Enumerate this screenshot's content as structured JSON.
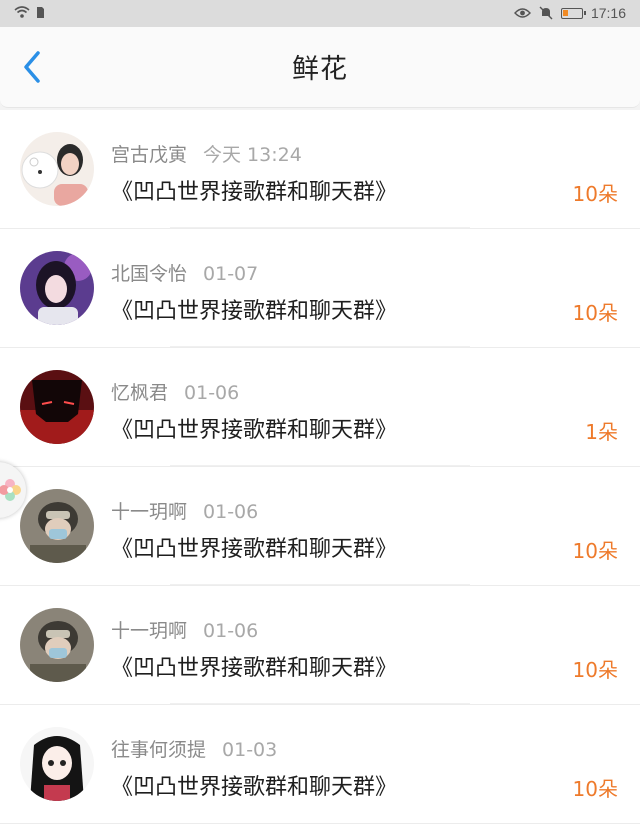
{
  "status_bar": {
    "time": "17:16",
    "icons": [
      "wifi-icon",
      "sim-icon",
      "eye-icon",
      "mute-bell-icon",
      "battery-icon"
    ]
  },
  "header": {
    "title": "鲜花",
    "back_icon": "chevron-left-icon"
  },
  "colors": {
    "accent_back": "#2a8fe6",
    "count_orange": "#ee7a2b",
    "meta_gray": "#9a9a9a"
  },
  "items": [
    {
      "name": "宫古戊寅",
      "date": "今天 13:24",
      "message": "《凹凸世界接歌群和聊天群》",
      "count": "10朵"
    },
    {
      "name": "北国令怡",
      "date": "01-07",
      "message": "《凹凸世界接歌群和聊天群》",
      "count": "10朵"
    },
    {
      "name": "忆枫君",
      "date": "01-06",
      "message": "《凹凸世界接歌群和聊天群》",
      "count": "1朵"
    },
    {
      "name": "十一玥啊",
      "date": "01-06",
      "message": "《凹凸世界接歌群和聊天群》",
      "count": "10朵"
    },
    {
      "name": "十一玥啊",
      "date": "01-06",
      "message": "《凹凸世界接歌群和聊天群》",
      "count": "10朵"
    },
    {
      "name": "往事何须提",
      "date": "01-03",
      "message": "《凹凸世界接歌群和聊天群》",
      "count": "10朵"
    }
  ]
}
